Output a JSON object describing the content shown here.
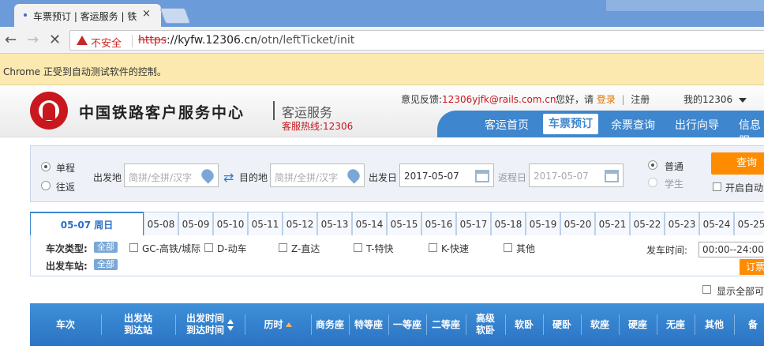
{
  "browser": {
    "tab_title": "车票预订 | 客运服务 | 铁",
    "tab_close": "×",
    "security_label": "不安全",
    "url_scheme": "https",
    "url_host": "://kyfw.12306.cn",
    "url_path": "/otn/leftTicket/init",
    "infobar_text": "Chrome 正受到自动测试软件的控制。"
  },
  "header": {
    "site_name": "中国铁路客户服务中心",
    "service_name": "客运服务",
    "hotline": "客服热线:12306",
    "feedback_label": "意见反馈:",
    "feedback_email": "12306yjfk@rails.com.cn",
    "greeting": "您好，请",
    "login": "登录",
    "separator": "|",
    "register": "注册",
    "my12306": "我的12306"
  },
  "nav": {
    "items": [
      "客运首页",
      "车票预订",
      "余票查询",
      "出行向导",
      "信息服"
    ],
    "active_index": 1
  },
  "search": {
    "trip_one_way": "单程",
    "trip_round": "往返",
    "from_label": "出发地",
    "from_placeholder": "简拼/全拼/汉字",
    "to_label": "目的地",
    "to_placeholder": "简拼/全拼/汉字",
    "depart_label": "出发日",
    "depart_date": "2017-05-07",
    "return_label": "返程日",
    "return_date": "2017-05-07",
    "ticket_normal": "普通",
    "ticket_student": "学生",
    "query_button": "查询",
    "auto_query": "开启自动"
  },
  "dates": {
    "active": "05-07  周日",
    "list": [
      "05-08",
      "05-09",
      "05-10",
      "05-11",
      "05-12",
      "05-13",
      "05-14",
      "05-15",
      "05-16",
      "05-17",
      "05-18",
      "05-19",
      "05-20",
      "05-21",
      "05-22",
      "05-23",
      "05-24",
      "05-25"
    ]
  },
  "filters": {
    "train_type_label": "车次类型:",
    "all": "全部",
    "types": [
      "GC-高铁/城际",
      "D-动车",
      "Z-直达",
      "T-特快",
      "K-快速",
      "其他"
    ],
    "station_label": "出发车站:",
    "time_label": "发车时间:",
    "time_value": "00:00--24:00",
    "order_tag": "订票",
    "show_all": "显示全部可"
  },
  "table": {
    "headers": [
      "车次",
      "出发站\n到达站",
      "出发时间\n到达时间",
      "历时",
      "商务座",
      "特等座",
      "一等座",
      "二等座",
      "高级\n软卧",
      "软卧",
      "硬卧",
      "软座",
      "硬座",
      "无座",
      "其他",
      "备"
    ]
  }
}
